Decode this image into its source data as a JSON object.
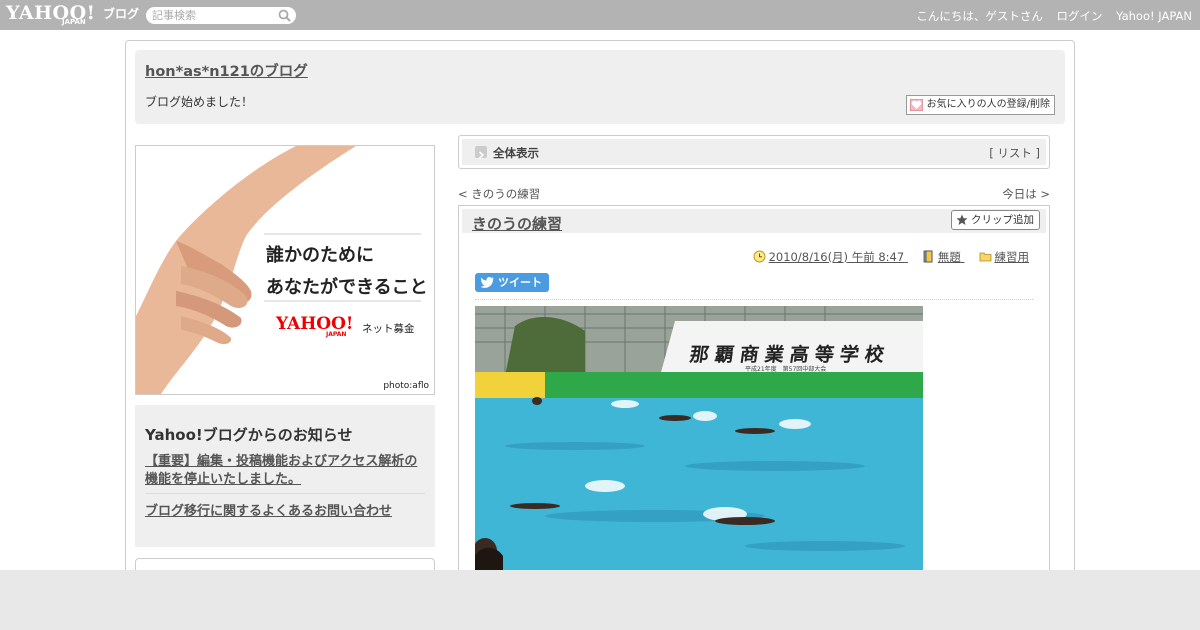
{
  "topbar": {
    "logo": "YAHOO!",
    "logo_sub": "JAPAN",
    "logo_service": "ブログ",
    "search_placeholder": "記事検索",
    "greeting": "こんにちは、ゲストさん",
    "login": "ログイン",
    "yahoo_japan": "Yahoo! JAPAN"
  },
  "header": {
    "blog_title": "hon*as*n121のブログ",
    "blog_desc": "ブログ始めました！",
    "fav_button": "お気に入りの人の登録/削除"
  },
  "banner": {
    "line1": "誰かのために",
    "line2": "あなたができること",
    "logo": "YAHOO!",
    "logo_sub": "JAPAN",
    "tagline": "ネット募金",
    "photo_credit": "photo:aflo"
  },
  "notice": {
    "title": "Yahoo!ブログからのお知らせ",
    "items": [
      "【重要】編集・投稿機能およびアクセス解析の機能を停止いたしました。",
      "ブログ移行に関するよくあるお問い合わせ"
    ]
  },
  "view_bar": {
    "label": "全体表示",
    "list_open": "[",
    "list_link": "リスト",
    "list_close": "]"
  },
  "nav": {
    "prev_mark": "<",
    "prev_link": "きのうの練習",
    "next_link": "今日は",
    "next_mark": ">"
  },
  "post": {
    "title": "きのうの練習",
    "clip_button": "クリップ追加",
    "date": "2010/8/16(月) 午前 8:47",
    "theme": "無題",
    "category": "練習用",
    "tweet": "ツイート",
    "photo_banner_text": "那覇商業高等学校",
    "photo_banner_sub": "平成21年度　第57回中部大会"
  },
  "colors": {
    "topbar": "#b3b3b3",
    "panel": "#efefef",
    "tweet": "#4a9be0",
    "pool": "#3fb6d6"
  }
}
